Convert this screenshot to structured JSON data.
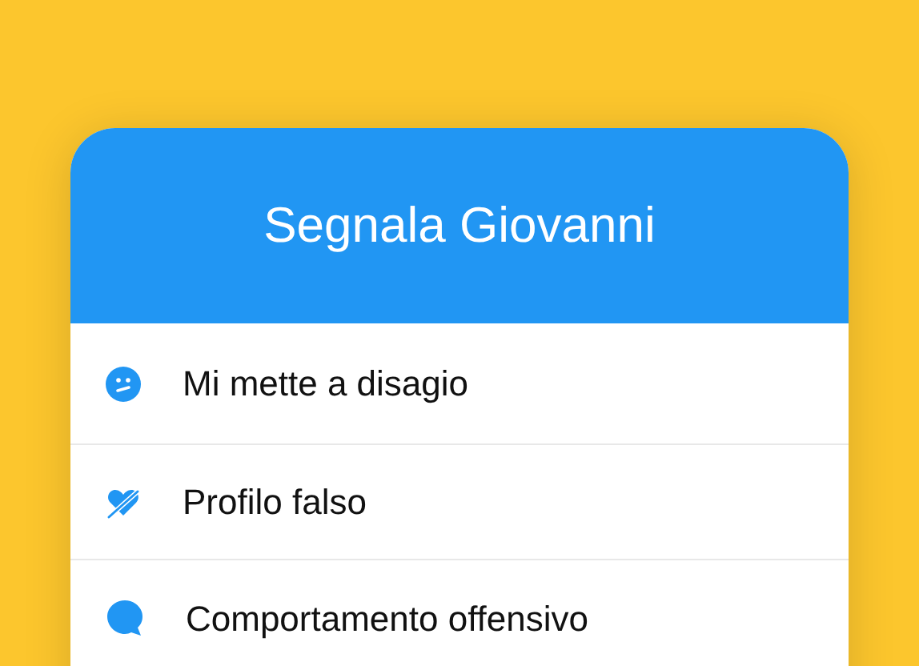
{
  "dialog": {
    "title": "Segnala Giovanni"
  },
  "options": [
    {
      "label": "Mi mette a disagio"
    },
    {
      "label": "Profilo falso"
    },
    {
      "label": "Comportamento offensivo"
    }
  ]
}
